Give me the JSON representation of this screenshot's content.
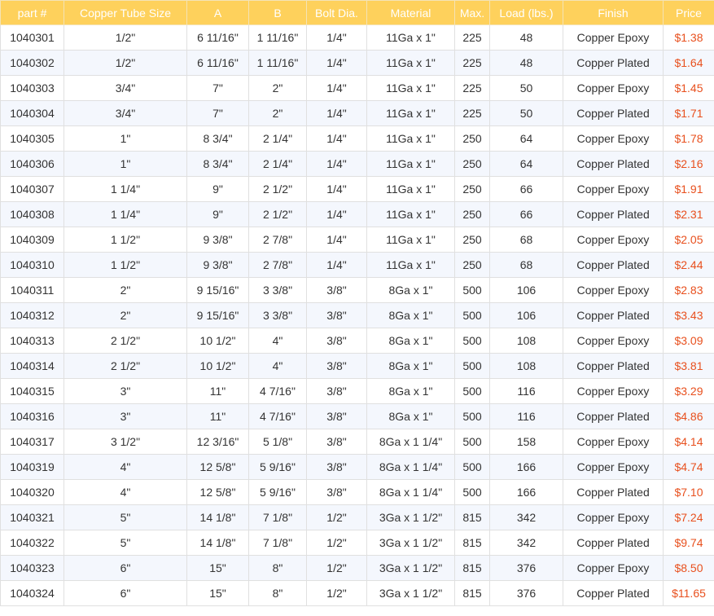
{
  "table": {
    "headers": [
      "part #",
      "Copper Tube Size",
      "A",
      "B",
      "Bolt Dia.",
      "Material",
      "Max.",
      "Load (lbs.)",
      "Finish",
      "Price"
    ],
    "rows": [
      [
        "1040301",
        "1/2\"",
        "6 11/16\"",
        "1 11/16\"",
        "1/4\"",
        "11Ga x 1\"",
        "225",
        "48",
        "Copper Epoxy",
        "$1.38"
      ],
      [
        "1040302",
        "1/2\"",
        "6 11/16\"",
        "1 11/16\"",
        "1/4\"",
        "11Ga x 1\"",
        "225",
        "48",
        "Copper Plated",
        "$1.64"
      ],
      [
        "1040303",
        "3/4\"",
        "7\"",
        "2\"",
        "1/4\"",
        "11Ga x 1\"",
        "225",
        "50",
        "Copper Epoxy",
        "$1.45"
      ],
      [
        "1040304",
        "3/4\"",
        "7\"",
        "2\"",
        "1/4\"",
        "11Ga x 1\"",
        "225",
        "50",
        "Copper Plated",
        "$1.71"
      ],
      [
        "1040305",
        "1\"",
        "8 3/4\"",
        "2 1/4\"",
        "1/4\"",
        "11Ga x 1\"",
        "250",
        "64",
        "Copper Epoxy",
        "$1.78"
      ],
      [
        "1040306",
        "1\"",
        "8 3/4\"",
        "2 1/4\"",
        "1/4\"",
        "11Ga x 1\"",
        "250",
        "64",
        "Copper Plated",
        "$2.16"
      ],
      [
        "1040307",
        "1 1/4\"",
        "9\"",
        "2 1/2\"",
        "1/4\"",
        "11Ga x 1\"",
        "250",
        "66",
        "Copper Epoxy",
        "$1.91"
      ],
      [
        "1040308",
        "1 1/4\"",
        "9\"",
        "2 1/2\"",
        "1/4\"",
        "11Ga x 1\"",
        "250",
        "66",
        "Copper Plated",
        "$2.31"
      ],
      [
        "1040309",
        "1 1/2\"",
        "9 3/8\"",
        "2 7/8\"",
        "1/4\"",
        "11Ga x 1\"",
        "250",
        "68",
        "Copper Epoxy",
        "$2.05"
      ],
      [
        "1040310",
        "1 1/2\"",
        "9 3/8\"",
        "2 7/8\"",
        "1/4\"",
        "11Ga x 1\"",
        "250",
        "68",
        "Copper Plated",
        "$2.44"
      ],
      [
        "1040311",
        "2\"",
        "9 15/16\"",
        "3 3/8\"",
        "3/8\"",
        "8Ga x 1\"",
        "500",
        "106",
        "Copper Epoxy",
        "$2.83"
      ],
      [
        "1040312",
        "2\"",
        "9 15/16\"",
        "3 3/8\"",
        "3/8\"",
        "8Ga x 1\"",
        "500",
        "106",
        "Copper Plated",
        "$3.43"
      ],
      [
        "1040313",
        "2 1/2\"",
        "10 1/2\"",
        "4\"",
        "3/8\"",
        "8Ga x 1\"",
        "500",
        "108",
        "Copper Epoxy",
        "$3.09"
      ],
      [
        "1040314",
        "2 1/2\"",
        "10 1/2\"",
        "4\"",
        "3/8\"",
        "8Ga x 1\"",
        "500",
        "108",
        "Copper Plated",
        "$3.81"
      ],
      [
        "1040315",
        "3\"",
        "11\"",
        "4 7/16\"",
        "3/8\"",
        "8Ga x 1\"",
        "500",
        "116",
        "Copper Epoxy",
        "$3.29"
      ],
      [
        "1040316",
        "3\"",
        "11\"",
        "4 7/16\"",
        "3/8\"",
        "8Ga x 1\"",
        "500",
        "116",
        "Copper Plated",
        "$4.86"
      ],
      [
        "1040317",
        "3 1/2\"",
        "12 3/16\"",
        "5 1/8\"",
        "3/8\"",
        "8Ga x 1 1/4\"",
        "500",
        "158",
        "Copper Epoxy",
        "$4.14"
      ],
      [
        "1040319",
        "4\"",
        "12 5/8\"",
        "5 9/16\"",
        "3/8\"",
        "8Ga x 1 1/4\"",
        "500",
        "166",
        "Copper Epoxy",
        "$4.74"
      ],
      [
        "1040320",
        "4\"",
        "12 5/8\"",
        "5 9/16\"",
        "3/8\"",
        "8Ga x 1 1/4\"",
        "500",
        "166",
        "Copper Plated",
        "$7.10"
      ],
      [
        "1040321",
        "5\"",
        "14 1/8\"",
        "7 1/8\"",
        "1/2\"",
        "3Ga x 1 1/2\"",
        "815",
        "342",
        "Copper Epoxy",
        "$7.24"
      ],
      [
        "1040322",
        "5\"",
        "14 1/8\"",
        "7 1/8\"",
        "1/2\"",
        "3Ga x 1 1/2\"",
        "815",
        "342",
        "Copper Plated",
        "$9.74"
      ],
      [
        "1040323",
        "6\"",
        "15\"",
        "8\"",
        "1/2\"",
        "3Ga x 1 1/2\"",
        "815",
        "376",
        "Copper Epoxy",
        "$8.50"
      ],
      [
        "1040324",
        "6\"",
        "15\"",
        "8\"",
        "1/2\"",
        "3Ga x 1 1/2\"",
        "815",
        "376",
        "Copper Plated",
        "$11.65"
      ]
    ]
  },
  "colors": {
    "header_bg": "#fed15c",
    "header_text": "#ffffff",
    "row_alt_bg": "#f4f7fd",
    "price_text": "#e8501e",
    "body_text": "#333333"
  }
}
